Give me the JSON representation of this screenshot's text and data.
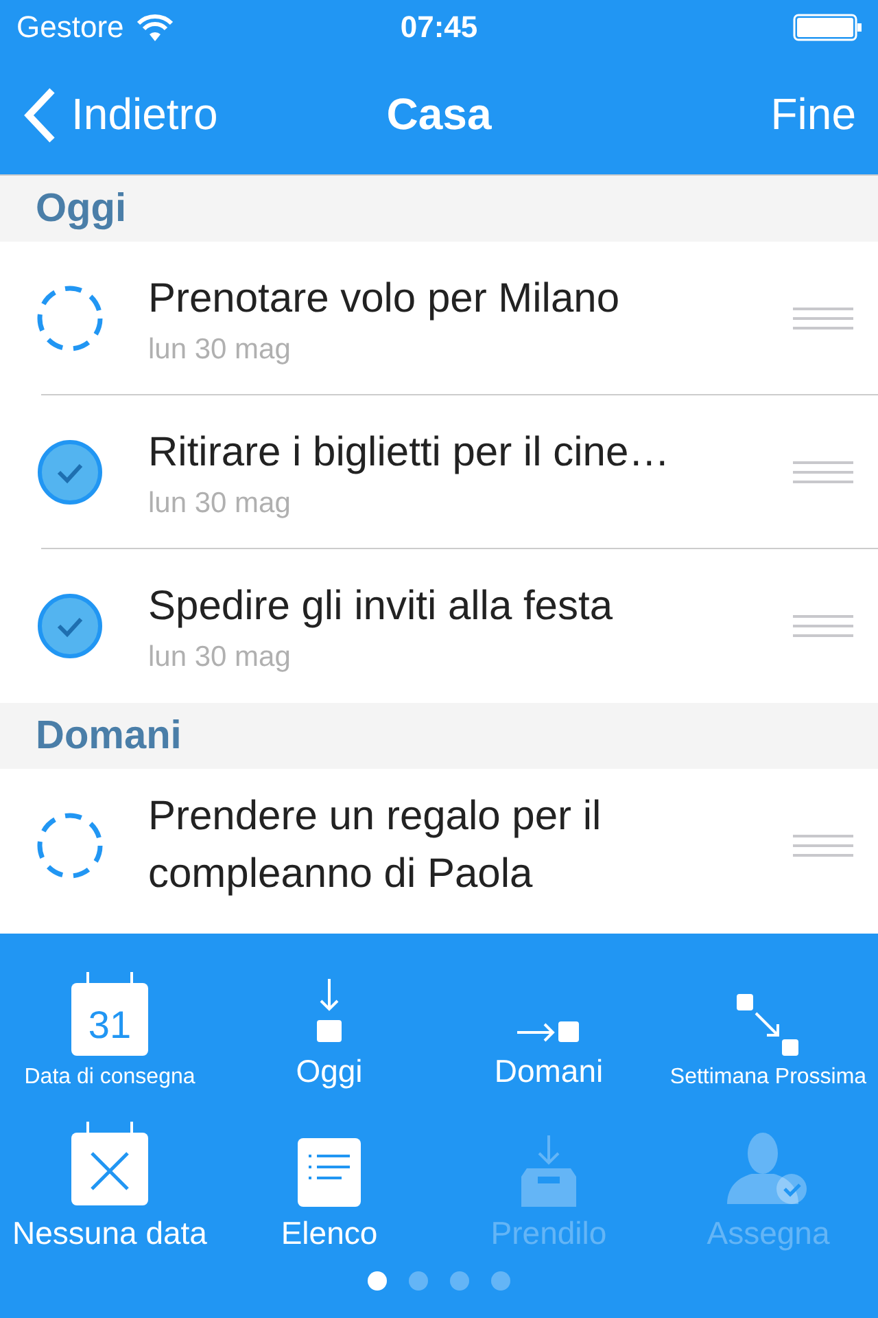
{
  "status_bar": {
    "carrier": "Gestore",
    "time": "07:45"
  },
  "nav": {
    "back": "Indietro",
    "title": "Casa",
    "done": "Fine"
  },
  "sections": [
    {
      "title": "Oggi",
      "tasks": [
        {
          "title": "Prenotare volo per Milano",
          "date": "lun 30 mag",
          "done": false
        },
        {
          "title": "Ritirare i biglietti per il cine…",
          "date": "lun 30 mag",
          "done": true
        },
        {
          "title": "Spedire gli inviti alla festa",
          "date": "lun 30 mag",
          "done": true
        }
      ]
    },
    {
      "title": "Domani",
      "tasks": [
        {
          "title": "Prendere un regalo per il compleanno di Paola",
          "done": false
        }
      ]
    }
  ],
  "actions": [
    {
      "kind": "calendar",
      "label": "Data di consegna",
      "badge": "31",
      "disabled": false
    },
    {
      "kind": "today",
      "label": "Oggi",
      "disabled": false
    },
    {
      "kind": "tomorrow",
      "label": "Domani",
      "disabled": false
    },
    {
      "kind": "nextweek",
      "label": "Settimana Prossima",
      "disabled": false
    },
    {
      "kind": "nodate",
      "label": "Nessuna data",
      "disabled": false
    },
    {
      "kind": "list",
      "label": "Elenco",
      "disabled": false
    },
    {
      "kind": "inbox",
      "label": "Prendilo",
      "disabled": true
    },
    {
      "kind": "assign",
      "label": "Assegna",
      "disabled": true
    }
  ],
  "pages": [
    {
      "selected": true
    },
    {
      "selected": false
    },
    {
      "selected": false
    },
    {
      "selected": false
    }
  ]
}
